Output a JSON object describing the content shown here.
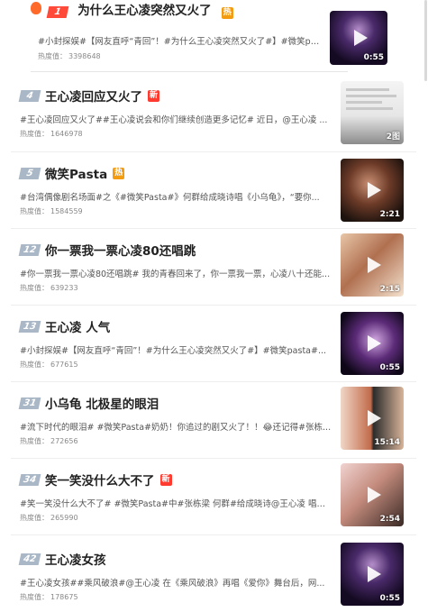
{
  "items": [
    {
      "rank": "1",
      "title": "为什么王心凌突然又火了",
      "tag": "热",
      "desc": "#小封探娱#【网友直呼“青回”！#为什么王心凌突然又火了#】#微笑pasta#...",
      "heat_label": "热度值：",
      "heat": "3398648",
      "duration": "0:55"
    },
    {
      "rank": "4",
      "title": "王心凌回应又火了",
      "tag": "新",
      "desc": "#王心凌回应又火了##王心凌说会和你们继续创造更多记忆# 近日，@王心凌 ...",
      "heat_label": "热度值：",
      "heat": "1646978",
      "duration": "2图"
    },
    {
      "rank": "5",
      "title": "微笑Pasta",
      "tag": "热",
      "desc": "#台湾偶像剧名场面#之《#微笑Pasta#》何群给成晓诗唱《小乌龟》，“要你...",
      "heat_label": "热度值：",
      "heat": "1584559",
      "duration": "2:21"
    },
    {
      "rank": "12",
      "title": "你一票我一票心凌80还唱跳",
      "tag": "",
      "desc": "#你一票我一票心凌80还唱跳# 我的青春回来了，你一票我一票，心凌八十还能...",
      "heat_label": "热度值：",
      "heat": "639233",
      "duration": "2:15"
    },
    {
      "rank": "13",
      "title": "王心凌 人气",
      "tag": "",
      "desc": "#小封探娱#【网友直呼“青回”！#为什么王心凌突然又火了#】#微笑pasta#...",
      "heat_label": "热度值：",
      "heat": "677615",
      "duration": "0:55"
    },
    {
      "rank": "31",
      "title": "小乌龟 北极星的眼泪",
      "tag": "",
      "desc": "#流下时代的眼泪# #微笑Pasta#奶奶！你追过的剧又火了！！😂还记得#张栋...",
      "heat_label": "热度值：",
      "heat": "272656",
      "duration": "15:14"
    },
    {
      "rank": "34",
      "title": "笑一笑没什么大不了",
      "tag": "新",
      "desc": "#笑一笑没什么大不了# #微笑Pasta#中#张栋梁 何群#给成晓诗@王心凌 唱《...",
      "heat_label": "热度值：",
      "heat": "265990",
      "duration": "2:54"
    },
    {
      "rank": "42",
      "title": "王心凌女孩",
      "tag": "",
      "desc": "#王心凌女孩##乘风破浪#@王心凌 在《乘风破浪》再唱《爱你》舞台后，网...",
      "heat_label": "热度值：",
      "heat": "178675",
      "duration": "0:55"
    }
  ],
  "colors": {
    "rank_badge": "#a9b7c6",
    "rank_top": "#ff4a3a",
    "tag_hot": "#f39c12",
    "tag_new": "#ff3b30"
  },
  "icons": [
    "fire-icon",
    "play-icon"
  ]
}
